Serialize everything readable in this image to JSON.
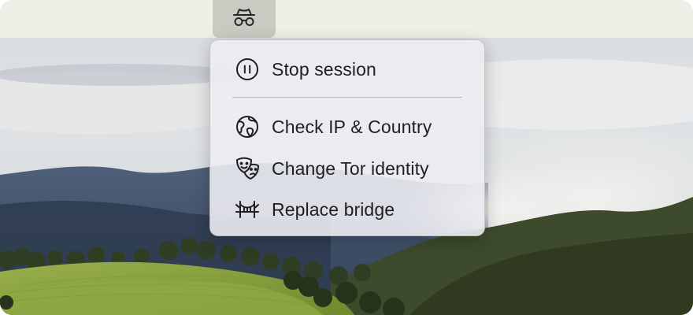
{
  "menubar": {
    "status_icon": "incognito-icon"
  },
  "menu": {
    "items": [
      {
        "label": "Stop session",
        "icon": "pause-circle-icon"
      },
      {
        "label": "Check IP & Country",
        "icon": "globe-icon"
      },
      {
        "label": "Change Tor identity",
        "icon": "masks-icon"
      },
      {
        "label": "Replace bridge",
        "icon": "bridge-icon"
      }
    ]
  },
  "colors": {
    "menubar": "#EFEEE7",
    "menu_background": "#ECECF2",
    "text": "#1F1F23"
  }
}
